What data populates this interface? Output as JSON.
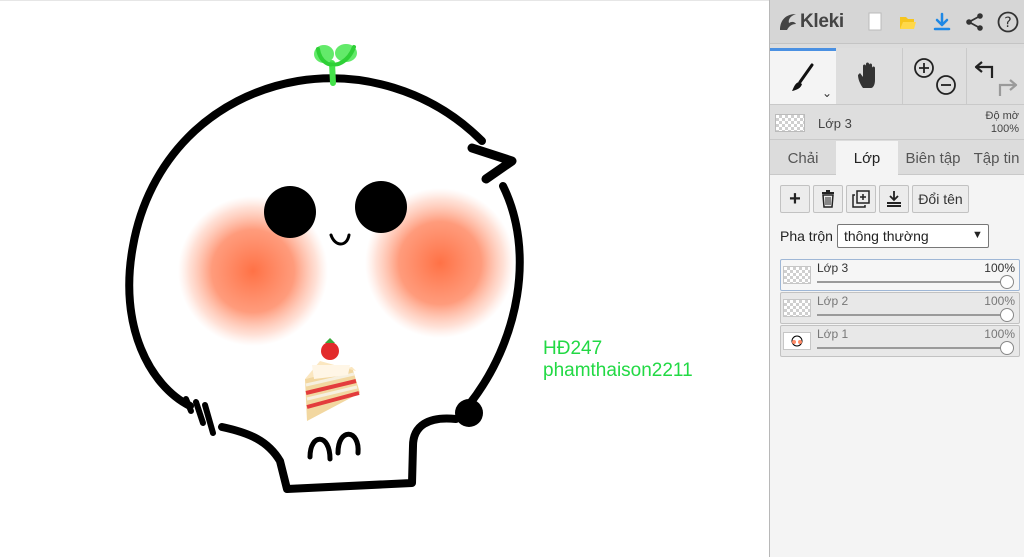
{
  "app": {
    "name": "Kleki"
  },
  "canvas": {
    "signature_line1": "HĐ247",
    "signature_line2": "phamthaison2211"
  },
  "topbar": {
    "icons": [
      "new-image-icon",
      "open-folder-icon",
      "download-icon",
      "share-icon",
      "help-icon"
    ]
  },
  "tools": {
    "brush": "brush-icon",
    "hand": "hand-icon",
    "zoom_in": "zoom-in-icon",
    "zoom_out": "zoom-out-icon",
    "undo": "undo-icon",
    "redo": "redo-icon",
    "caret": "⌄"
  },
  "active_layer": {
    "name": "Lớp 3",
    "opacity_label": "Độ mờ",
    "opacity_value": "100%"
  },
  "tabs": [
    {
      "label": "Chải",
      "active": false
    },
    {
      "label": "Lớp",
      "active": true
    },
    {
      "label": "Biên tập",
      "active": false
    },
    {
      "label": "Tập tin",
      "active": false
    }
  ],
  "layers_panel": {
    "add_symbol": "+",
    "rename_label": "Đổi tên",
    "blend_label": "Pha trộn",
    "blend_value": "thông thường",
    "layers": [
      {
        "name": "Lớp 3",
        "opacity": "100%",
        "opacity_fraction": 1.0,
        "selected": true
      },
      {
        "name": "Lớp 2",
        "opacity": "100%",
        "opacity_fraction": 1.0,
        "selected": false
      },
      {
        "name": "Lớp 1",
        "opacity": "100%",
        "opacity_fraction": 1.0,
        "selected": false
      }
    ]
  },
  "colors": {
    "accent": "#4a90e2",
    "signature_green": "#22d944",
    "sprout_green": "#44e24a",
    "blush": "#ff7a50",
    "download_blue": "#1e88e5",
    "folder_yellow": "#f6c51e"
  }
}
